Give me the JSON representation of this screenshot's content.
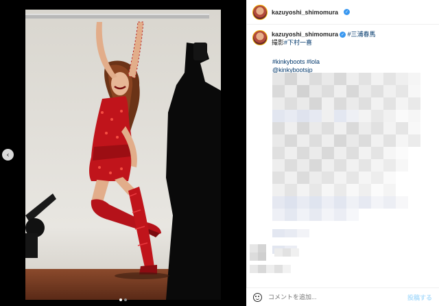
{
  "post": {
    "username": "kazuyoshi_shimomura",
    "caption_tag1": "#三浦春馬",
    "caption_line2_prefix": "撮影",
    "caption_tag2": "#下村一喜",
    "hashtags": "#kinkyboots #lola",
    "mention": "@kinkybootsjp"
  },
  "comment": {
    "placeholder": "コメントを追加...",
    "post_label": "投稿する"
  },
  "carousel": {
    "prev_icon": "‹",
    "dots": 2,
    "active_dot": 0
  },
  "colors": {
    "link": "#00376b",
    "verified": "#3897f0",
    "dress_red": "#c0141b",
    "post_btn": "#b2dffc"
  }
}
